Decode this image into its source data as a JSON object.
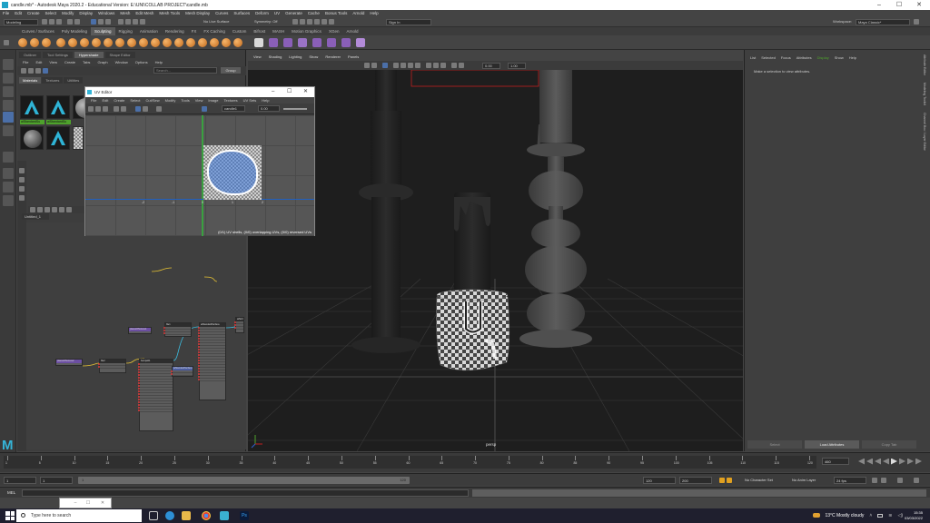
{
  "window": {
    "title": "candle.mb* - Autodesk Maya 2020.2 - Educational Version: E:\\UNI\\COLLAB PROJECT\\candle.mb",
    "controls": [
      "–",
      "☐",
      "✕"
    ]
  },
  "menubar": [
    "File",
    "Edit",
    "Create",
    "Select",
    "Modify",
    "Display",
    "Windows",
    "Mesh",
    "Edit Mesh",
    "Mesh Tools",
    "Mesh Display",
    "Curves",
    "Surfaces",
    "Deform",
    "UV",
    "Generate",
    "Cache",
    "Bonus Tools",
    "Arnold",
    "Help"
  ],
  "statusline": {
    "mode": "Modeling",
    "surface": "No Live Surface",
    "symmetry": "Symmetry: Off",
    "signin": "Sign In",
    "workspace_label": "Workspace:",
    "workspace": "Maya Classic*"
  },
  "shelf_tabs": [
    "Curves / Surfaces",
    "Poly Modeling",
    "Sculpting",
    "Rigging",
    "Animation",
    "Rendering",
    "FX",
    "FX Caching",
    "Custom",
    "Bifrost",
    "MASH",
    "Motion Graphics",
    "XGen",
    "Arnold"
  ],
  "shelf_active": "Sculpting",
  "hypershade": {
    "tabs": [
      "Outliner",
      "Tool Settings",
      "Hypershade",
      "Shape Editor"
    ],
    "menu": [
      "File",
      "Edit",
      "View",
      "Create",
      "Tabs",
      "Graph",
      "Window",
      "Options",
      "Help"
    ],
    "browser_label": "Browser",
    "search_placeholder": "Search...",
    "group_button": "Group",
    "material_tabs": [
      "Materials",
      "Textures",
      "Utilities"
    ],
    "swatch_labels": [
      "aiStandardSu",
      "aiStandardSu",
      "",
      ""
    ],
    "workspace_tab": "Untitled_1",
    "nodes": [
      {
        "title": "place2dTexture1",
        "color": "purple"
      },
      {
        "title": "file1",
        "color": "grey"
      },
      {
        "title": "place2dTexture2",
        "color": "purple"
      },
      {
        "title": "file2",
        "color": "grey"
      },
      {
        "title": "bump2d1",
        "color": "grey"
      },
      {
        "title": "aiStandardSurface",
        "color": "grey"
      },
      {
        "title": "aiStandardSurface2SG",
        "color": "blue"
      },
      {
        "title": "aiNormalMap",
        "color": "grey"
      }
    ]
  },
  "uv_editor": {
    "title": "UV Editor",
    "menu": [
      "File",
      "Edit",
      "Create",
      "Select",
      "Cut/Sew",
      "Modify",
      "Tools",
      "View",
      "Image",
      "Textures",
      "UV Sets",
      "Help"
    ],
    "texture_field": "candle1",
    "texture_value": "0.00",
    "status": "(0/1) UV shells, (0/0) overlapping UVs, (0/0) reversed UVs",
    "ruler_ticks": [
      "-2",
      "-1",
      "0",
      "1",
      "2"
    ]
  },
  "viewport": {
    "menu": [
      "View",
      "Shading",
      "Lighting",
      "Show",
      "Renderer",
      "Panels"
    ],
    "field_a": "0.00",
    "field_b": "1.00",
    "camera_label": "persp"
  },
  "attribute_editor": {
    "menu": [
      "List",
      "Selected",
      "Focus",
      "Attributes",
      "Display",
      "Show",
      "Help"
    ],
    "menu_active": "Display",
    "message": "Make a selection to view attributes.",
    "side_tabs": [
      "Attribute Editor",
      "Modeling Toolkit",
      "Channel Box / Layer Editor"
    ],
    "buttons": [
      "Select",
      "Load Attributes",
      "Copy Tab"
    ]
  },
  "timeslider": {
    "ticks": [
      "1",
      "5",
      "10",
      "15",
      "20",
      "25",
      "30",
      "35",
      "40",
      "45",
      "50",
      "55",
      "60",
      "65",
      "70",
      "75",
      "80",
      "85",
      "90",
      "95",
      "100",
      "105",
      "110",
      "115",
      "120"
    ],
    "current_frame": "460"
  },
  "range": {
    "start": "1",
    "start_inner": "1",
    "bar_start": "1",
    "bar_end": "120",
    "end_inner": "120",
    "end": "200",
    "character_set": "No Character Set",
    "anim_layer": "No Anim Layer",
    "fps": "24 fps"
  },
  "cmdline": {
    "label": "MEL"
  },
  "taskbar": {
    "search_placeholder": "Type here to search",
    "weather": "13°C  Mostly cloudy",
    "time": "15:35",
    "date": "03/03/2022"
  },
  "colors": {
    "maya_blue": "#35b5d8",
    "active_green": "#4ea22c",
    "node_purple": "#6c4fa2"
  }
}
